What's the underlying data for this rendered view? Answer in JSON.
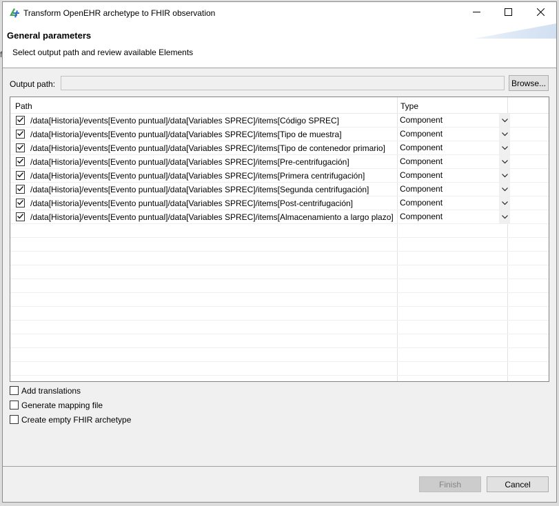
{
  "window": {
    "title": "Transform OpenEHR archetype to FHIR observation"
  },
  "header": {
    "title": "General parameters",
    "subtitle": "Select output path and review available Elements"
  },
  "output": {
    "label": "Output path:",
    "value": "",
    "browse_label": "Browse..."
  },
  "table": {
    "columns": [
      "Path",
      "Type"
    ],
    "rows": [
      {
        "checked": true,
        "path": "/data[Historia]/events[Evento puntual]/data[Variables SPREC]/items[Código SPREC]",
        "type": "Component"
      },
      {
        "checked": true,
        "path": "/data[Historia]/events[Evento puntual]/data[Variables SPREC]/items[Tipo de muestra]",
        "type": "Component"
      },
      {
        "checked": true,
        "path": "/data[Historia]/events[Evento puntual]/data[Variables SPREC]/items[Tipo de contenedor primario]",
        "type": "Component"
      },
      {
        "checked": true,
        "path": "/data[Historia]/events[Evento puntual]/data[Variables SPREC]/items[Pre-centrifugación]",
        "type": "Component"
      },
      {
        "checked": true,
        "path": "/data[Historia]/events[Evento puntual]/data[Variables SPREC]/items[Primera centrifugación]",
        "type": "Component"
      },
      {
        "checked": true,
        "path": "/data[Historia]/events[Evento puntual]/data[Variables SPREC]/items[Segunda centrifugación]",
        "type": "Component"
      },
      {
        "checked": true,
        "path": "/data[Historia]/events[Evento puntual]/data[Variables SPREC]/items[Post-centrifugación]",
        "type": "Component"
      },
      {
        "checked": true,
        "path": "/data[Historia]/events[Evento puntual]/data[Variables SPREC]/items[Almacenamiento a largo plazo]",
        "type": "Component"
      }
    ]
  },
  "options": [
    {
      "label": "Add translations",
      "checked": false
    },
    {
      "label": "Generate mapping file",
      "checked": false
    },
    {
      "label": "Create empty FHIR archetype",
      "checked": false
    }
  ],
  "footer": {
    "finish_label": "Finish",
    "finish_enabled": false,
    "cancel_label": "Cancel"
  },
  "background": {
    "edge_text": "f"
  },
  "colors": {
    "dialog_bg": "#f0f0f0",
    "finish_disabled_bg": "#cccccc",
    "icon_green": "#3fa84b",
    "icon_blue": "#2f6fbd"
  }
}
